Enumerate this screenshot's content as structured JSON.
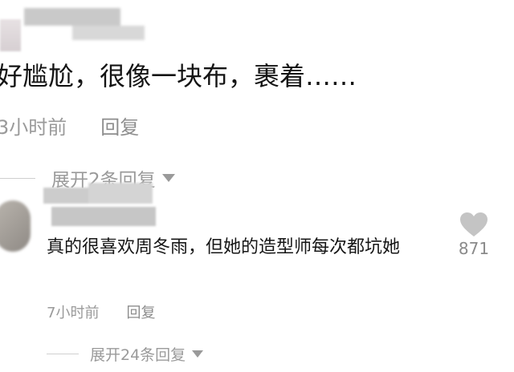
{
  "comments": [
    {
      "text": "好尴尬，很像一块布，裹着……",
      "time": "3小时前",
      "reply_label": "回复",
      "expand_label": "展开2条回复"
    },
    {
      "text": "真的很喜欢周冬雨，但她的造型师每次都坑她",
      "time": "7小时前",
      "reply_label": "回复",
      "expand_label": "展开24条回复",
      "like_count": "871"
    }
  ],
  "icons": {
    "like": "heart-icon",
    "expand": "caret-down-icon"
  },
  "colors": {
    "text": "#161616",
    "meta": "#9a9a9a",
    "heart": "#c4c4c4",
    "background": "#ffffff"
  }
}
